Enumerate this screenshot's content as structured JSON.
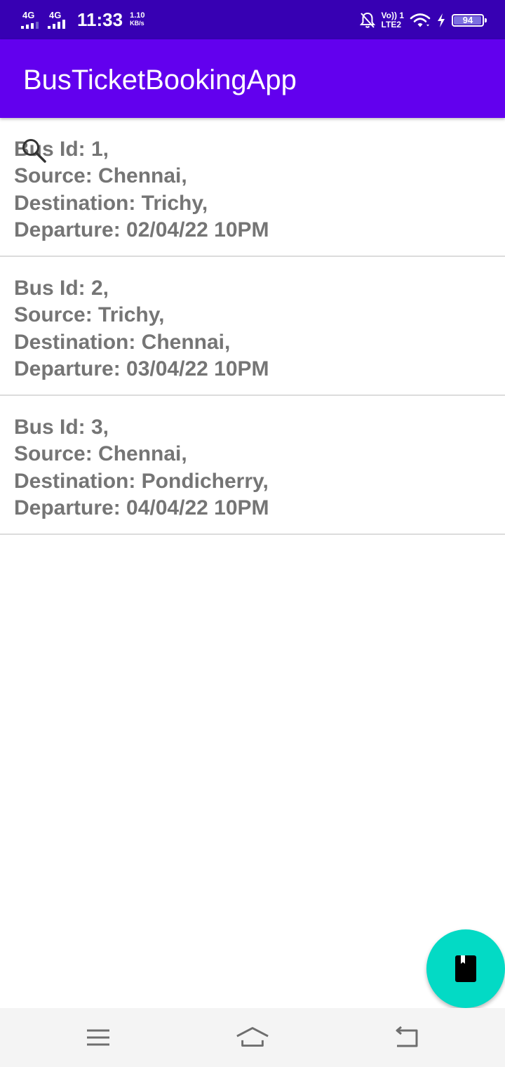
{
  "status_bar": {
    "network1": "4G",
    "network2": "4G",
    "time": "11:33",
    "speed_value": "1.10",
    "speed_unit": "KB/s",
    "volte_top": "Vo)) 1",
    "volte_bottom": "LTE2",
    "battery_level": "94",
    "background_color": "#3700b3"
  },
  "app_bar": {
    "title": "BusTicketBookingApp",
    "background_color": "#6200ee"
  },
  "buses": [
    {
      "id_line": "Bus Id: 1,",
      "source_line": "Source: Chennai,",
      "destination_line": "Destination: Trichy,",
      "departure_line": "Departure: 02/04/22 10PM"
    },
    {
      "id_line": "Bus Id: 2,",
      "source_line": "Source: Trichy,",
      "destination_line": "Destination: Chennai,",
      "departure_line": "Departure: 03/04/22 10PM"
    },
    {
      "id_line": "Bus Id: 3,",
      "source_line": "Source: Chennai,",
      "destination_line": "Destination: Pondicherry,",
      "departure_line": "Departure: 04/04/22 10PM"
    }
  ],
  "icons": {
    "overlay": "search-icon",
    "fab": "book-icon",
    "nav": [
      "menu-icon",
      "home-icon",
      "back-icon"
    ]
  },
  "fab": {
    "color": "#03dac5"
  }
}
